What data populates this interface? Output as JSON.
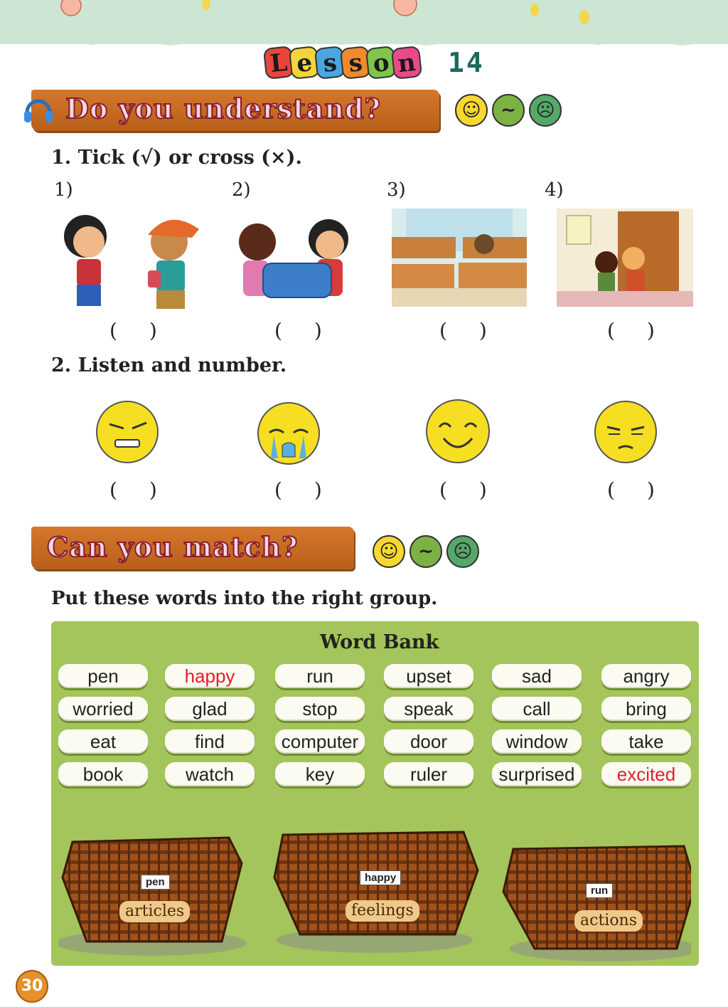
{
  "lesson": {
    "letters": [
      "L",
      "e",
      "s",
      "s",
      "o",
      "n"
    ],
    "number": "14"
  },
  "section1": {
    "title": "Do you understand?",
    "q1": {
      "instruction": "1. Tick (√) or cross (×).",
      "items": [
        {
          "label": "1)",
          "answer": "(  )"
        },
        {
          "label": "2)",
          "answer": "(  )"
        },
        {
          "label": "3)",
          "answer": "(  )"
        },
        {
          "label": "4)",
          "answer": "(  )"
        }
      ]
    },
    "q2": {
      "instruction": "2. Listen and number.",
      "answers": [
        "(  )",
        "(  )",
        "(  )",
        "(  )"
      ]
    }
  },
  "section2": {
    "title": "Can you match?",
    "instruction": "Put these words into the right group.",
    "word_bank_title": "Word Bank",
    "words": [
      [
        "pen",
        "happy",
        "run",
        "upset",
        "sad",
        "angry"
      ],
      [
        "worried",
        "glad",
        "stop",
        "speak",
        "call",
        "bring"
      ],
      [
        "eat",
        "find",
        "computer",
        "door",
        "window",
        "take"
      ],
      [
        "book",
        "watch",
        "key",
        "ruler",
        "surprised",
        "excited"
      ]
    ],
    "highlighted_words": [
      "happy",
      "excited"
    ],
    "baskets": [
      {
        "card": "pen",
        "label": "articles"
      },
      {
        "card": "happy",
        "label": "feelings"
      },
      {
        "card": "run",
        "label": "actions"
      }
    ]
  },
  "page_number": "30",
  "colors": {
    "banner": "#c96a22",
    "word_bank_bg": "#a4c45c",
    "highlight_text": "#e0202a",
    "lesson_number": "#1b6b5a"
  }
}
